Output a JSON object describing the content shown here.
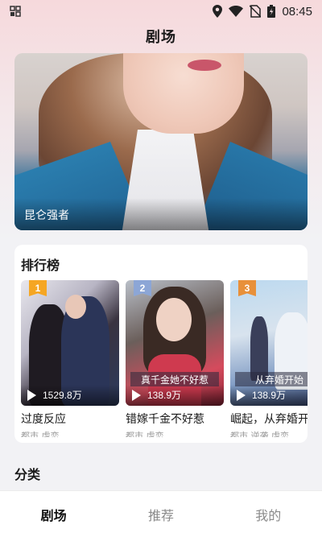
{
  "status_bar": {
    "time": "08:45",
    "icons": [
      "notification-icon",
      "location-icon",
      "wifi-icon",
      "no-sim-icon",
      "battery-icon"
    ]
  },
  "header": {
    "title": "剧场"
  },
  "banner": {
    "caption": "昆仑强者"
  },
  "ranking": {
    "title": "排行榜",
    "items": [
      {
        "rank": "1",
        "badge_color": "#f5a623",
        "plays": "1529.8万",
        "title": "过度反应",
        "tags": "都市 虐恋",
        "poster_text": ""
      },
      {
        "rank": "2",
        "badge_color": "#8ca6d6",
        "plays": "138.9万",
        "title": "错嫁千金不好惹",
        "tags": "都市 虐恋",
        "poster_text": "真千金她不好惹"
      },
      {
        "rank": "3",
        "badge_color": "#e8903a",
        "plays": "138.9万",
        "title": "崛起，从弃婚开",
        "tags": "都市 逆袭 虐恋",
        "poster_text": "从弃婚开始"
      }
    ]
  },
  "category": {
    "title": "分类"
  },
  "bottom_nav": {
    "items": [
      {
        "label": "剧场",
        "active": true
      },
      {
        "label": "推荐",
        "active": false
      },
      {
        "label": "我的",
        "active": false
      }
    ]
  }
}
